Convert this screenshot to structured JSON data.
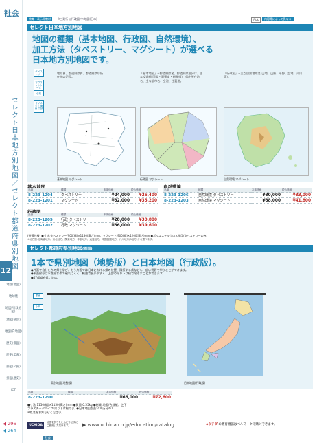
{
  "sidebar": {
    "category": "社会",
    "title": "セレクト日本地方別地図／セレクト都道府県別地図",
    "page_no": "12",
    "sub_items": [
      "地理(地図)",
      "地球儀",
      "地図(行政地図)",
      "地図(県別)",
      "地図(白地図)",
      "歴史(掛図)",
      "歴史(年表)",
      "掛図(公民)",
      "掛図(歴史)",
      "ICT"
    ],
    "page_ref_1": "296",
    "page_ref_2": "264"
  },
  "header": {
    "badge": "教育・表示用教材",
    "legend": "※□発行 ◎行政図 中:地図(日本)",
    "tag": "日本",
    "note": "内容等によって異なる"
  },
  "section1": {
    "title": "セレクト日本地方別地図",
    "headline": [
      "地図の種類（基本地図、行政図、自然環境）、",
      "加工方法（タペストリー、マグシート）が選べる",
      "日本地方別地図です。"
    ],
    "tags": [
      "タペストリー",
      "マグネットシート",
      "小判",
      "マグネット 関東 中部"
    ],
    "descs": [
      "地方界、都道府県界、都道府県庁所在地の記号。",
      "「基本地図」+都道府県名、都道府県色分け、主な交通網(国道・高速道・新幹線)、県庁所在地名、主な都市名、空港、主要港。",
      "「行政図」+主な自然地域名(山地、山脈、平野、盆地、河川等)。"
    ],
    "captions": [
      "基本地図 マグシート",
      "行政図 マグシート",
      "自然環境 マグシート"
    ]
  },
  "tables": {
    "headers": [
      "品番",
      "種類",
      "本体価格",
      "税込価格"
    ],
    "kihon": {
      "title": "基本地図",
      "rows": [
        [
          "8-223-1204",
          "タペストリー",
          "¥24,000",
          "¥26,400"
        ],
        [
          "8-223-1201",
          "マグシート",
          "¥32,000",
          "¥35,200"
        ]
      ]
    },
    "gyosei": {
      "title": "行政図",
      "rows": [
        [
          "8-223-1205",
          "行政 タペストリー",
          "¥28,000",
          "¥30,800"
        ],
        [
          "8-223-1202",
          "行政 マグシート",
          "¥36,000",
          "¥39,600"
        ]
      ]
    },
    "shizen": {
      "title": "自然環境",
      "rows": [
        [
          "8-223-1206",
          "自然環境 タペストリー",
          "¥30,000",
          "¥33,000"
        ],
        [
          "8-223-1203",
          "自然環境 マグシート",
          "¥38,000",
          "¥41,800"
        ]
      ]
    },
    "note": "(共通仕様) ●寸法:タペストリー/900(幅)×1180(高さ)mm、マグシート/900(幅)×1200(高さ)mm ●ポリエステルクロス使用(タペストリーのみ)",
    "note2": "※地方別:北海道地方、東北地方、関東地方、中部地方、近畿地方、中国四国地方、九州地方(8地方)から選べます。"
  },
  "section2": {
    "title": "セレクト都道府県別地図",
    "title_suffix": "(両面)",
    "headline": "1本で県別地図（地勢版）と日本地図（行政版）。",
    "bullets": [
      "●片面で自分たちの県を学び、もう片面では日本における県の位置、隣接する県なども、広い視野で学ぶことができます。",
      "●表面保存は水性紙なので破れにくく、軽量で扱いやすく、上部の吊り下げ紐で吊るすことができます。",
      "●47都道府県に対応。"
    ],
    "tags": [
      "表面",
      "小判"
    ],
    "captions": [
      "県別地図(地勢版)",
      "日本地図(行政版)"
    ],
    "row": [
      "8-223-1290",
      "",
      "¥66,000",
      "¥72,600"
    ],
    "spec": [
      "●寸法:1150(幅)×1150(高さ)mm ●質量:0.55kg ●材質:地図/合成紙、上下",
      "プラスチックパイプ(吊り下げ紐付き) ●日本地図版面:200万分の1",
      "※県名をお知らせください。"
    ]
  },
  "footer": {
    "small": "地図を折りたたんだりせずに\nご使用いただけます。",
    "url": "www.uchida.co.jp/education/catalog",
    "brand": "UCHIDA",
    "right": "の教育機器はベルマークで購入できます。",
    "bottom": "社会"
  }
}
